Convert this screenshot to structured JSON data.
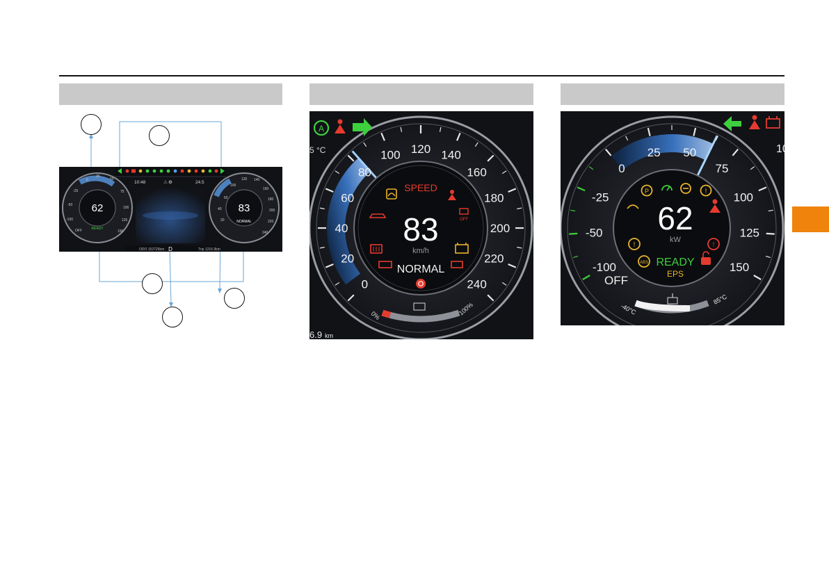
{
  "overview": {
    "time": "10:48",
    "outside_temp": "24.5",
    "odometer_label": "ODO",
    "odometer": "152729",
    "odometer_unit": "km",
    "gear": "D",
    "trip_label": "Trip",
    "trip": "1216.9",
    "trip_unit": "km"
  },
  "speedometer": {
    "speed": "83",
    "unit": "km/h",
    "warning_text": "SPEED",
    "drive_mode": "NORMAL",
    "scale": [
      "0",
      "20",
      "40",
      "60",
      "80",
      "100",
      "120",
      "140",
      "160",
      "180",
      "200",
      "220",
      "240"
    ],
    "soc_min": "0%",
    "soc_max": "100%",
    "corner_temp": "5 °C",
    "corner_distance": "6.9",
    "corner_distance_unit": "km",
    "esc_off_label": "OFF",
    "level": {
      "speed_kmh": 83,
      "max_kmh": 240,
      "soc_percent": 10
    }
  },
  "power_meter": {
    "power": "62",
    "unit": "kW",
    "status": "READY",
    "eps": "EPS",
    "off": "OFF",
    "scale": [
      "-100",
      "-50",
      "-25",
      "0",
      "25",
      "50",
      "75",
      "100",
      "125",
      "150"
    ],
    "temp_min": "-40°C",
    "temp_max": "85°C",
    "corner_value": "10",
    "level": {
      "power_kw": 62,
      "coolant_fraction": 0.75
    }
  },
  "colors": {
    "accent_blue": "#5a9be6",
    "warning_red": "#e53b2f",
    "amber": "#e8b42c",
    "indicator_green": "#3ecf3e",
    "chapter_tab": "#f0830c"
  },
  "icons": [
    "auto-hold-icon",
    "seatbelt-warning-icon",
    "turn-left-arrow-icon",
    "turn-right-arrow-icon",
    "battery-warning-icon",
    "esc-icon",
    "parking-brake-icon",
    "abs-icon",
    "airbag-icon",
    "door-open-icon",
    "cruise-icon",
    "coolant-temp-icon"
  ]
}
